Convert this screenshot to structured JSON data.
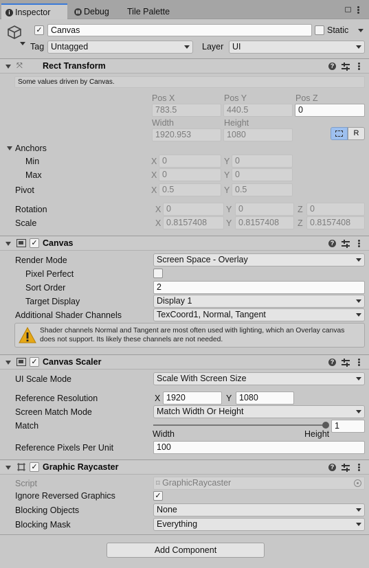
{
  "tabs": [
    {
      "label": "Inspector",
      "icon": "info-icon"
    },
    {
      "label": "Debug",
      "icon": "pause-icon"
    },
    {
      "label": "Tile Palette"
    }
  ],
  "object": {
    "name": "Canvas",
    "static_label": "Static",
    "tag_label": "Tag",
    "tag_value": "Untagged",
    "layer_label": "Layer",
    "layer_value": "UI"
  },
  "rect_transform": {
    "title": "Rect Transform",
    "driven_note": "Some values driven by Canvas.",
    "pos_x_label": "Pos X",
    "pos_y_label": "Pos Y",
    "pos_z_label": "Pos Z",
    "pos_x": "783.5",
    "pos_y": "440.5",
    "pos_z": "0",
    "width_label": "Width",
    "height_label": "Height",
    "width": "1920.953",
    "height": "1080",
    "r_button": "R",
    "anchors_label": "Anchors",
    "min_label": "Min",
    "max_label": "Max",
    "x_label": "X",
    "y_label": "Y",
    "z_label": "Z",
    "min_x": "0",
    "min_y": "0",
    "max_x": "0",
    "max_y": "0",
    "pivot_label": "Pivot",
    "pivot_x": "0.5",
    "pivot_y": "0.5",
    "rotation_label": "Rotation",
    "rot_x": "0",
    "rot_y": "0",
    "rot_z": "0",
    "scale_label": "Scale",
    "scale_x": "0.8157408",
    "scale_y": "0.8157408",
    "scale_z": "0.8157408"
  },
  "canvas": {
    "title": "Canvas",
    "render_mode_label": "Render Mode",
    "render_mode": "Screen Space - Overlay",
    "pixel_perfect_label": "Pixel Perfect",
    "sort_order_label": "Sort Order",
    "sort_order": "2",
    "target_display_label": "Target Display",
    "target_display": "Display 1",
    "shader_channels_label": "Additional Shader Channels",
    "shader_channels": "TexCoord1, Normal, Tangent",
    "warning_line1": "Shader channels Normal and Tangent are most often used with lighting, which an Overlay canvas",
    "warning_line2": "does not support. Its likely these channels are not needed."
  },
  "canvas_scaler": {
    "title": "Canvas Scaler",
    "ui_scale_mode_label": "UI Scale Mode",
    "ui_scale_mode": "Scale With Screen Size",
    "ref_res_label": "Reference Resolution",
    "x_label": "X",
    "y_label": "Y",
    "ref_x": "1920",
    "ref_y": "1080",
    "match_mode_label": "Screen Match Mode",
    "match_mode": "Match Width Or Height",
    "match_label": "Match",
    "match_value": "1",
    "match_fraction": 1,
    "width_label": "Width",
    "height_label": "Height",
    "ref_ppu_label": "Reference Pixels Per Unit",
    "ref_ppu": "100"
  },
  "graphic_raycaster": {
    "title": "Graphic Raycaster",
    "script_label": "Script",
    "script_value": "GraphicRaycaster",
    "ignore_reversed_label": "Ignore Reversed Graphics",
    "blocking_objects_label": "Blocking Objects",
    "blocking_objects": "None",
    "blocking_mask_label": "Blocking Mask",
    "blocking_mask": "Everything"
  },
  "add_component": "Add Component",
  "colors": {
    "accent": "#3a79d8",
    "warning": "#e6a817",
    "panel": "#c8c8c8"
  }
}
